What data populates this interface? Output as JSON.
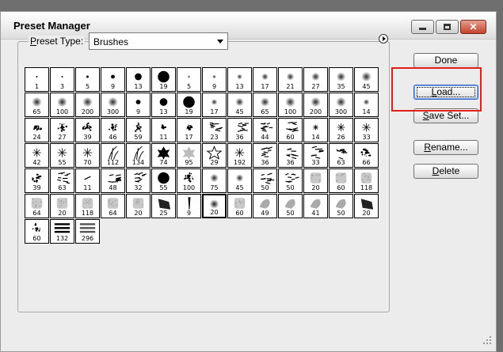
{
  "window": {
    "title": "Preset Manager"
  },
  "preset_type": {
    "label": "Preset Type:",
    "value": "Brushes"
  },
  "buttons": {
    "done": "Done",
    "load": "Load...",
    "save_set": "Save Set...",
    "rename": "Rename...",
    "delete": "Delete"
  },
  "colors": {
    "highlight": "#e0201a"
  },
  "brushes": [
    {
      "size": "1",
      "kind": "hard",
      "d": 2
    },
    {
      "size": "3",
      "kind": "hard",
      "d": 2
    },
    {
      "size": "5",
      "kind": "hard",
      "d": 3
    },
    {
      "size": "9",
      "kind": "hard",
      "d": 5
    },
    {
      "size": "13",
      "kind": "hard",
      "d": 9
    },
    {
      "size": "19",
      "kind": "hard",
      "d": 15
    },
    {
      "size": "5",
      "kind": "soft",
      "d": 3
    },
    {
      "size": "9",
      "kind": "soft",
      "d": 5
    },
    {
      "size": "13",
      "kind": "soft",
      "d": 7
    },
    {
      "size": "17",
      "kind": "soft",
      "d": 9
    },
    {
      "size": "21",
      "kind": "soft",
      "d": 10
    },
    {
      "size": "27",
      "kind": "soft",
      "d": 11
    },
    {
      "size": "35",
      "kind": "soft",
      "d": 12
    },
    {
      "size": "45",
      "kind": "soft",
      "d": 13
    },
    {
      "size": "65",
      "kind": "soft",
      "d": 13
    },
    {
      "size": "100",
      "kind": "soft",
      "d": 13
    },
    {
      "size": "200",
      "kind": "soft",
      "d": 13
    },
    {
      "size": "300",
      "kind": "soft",
      "d": 13
    },
    {
      "size": "9",
      "kind": "hard",
      "d": 6
    },
    {
      "size": "13",
      "kind": "hard",
      "d": 10
    },
    {
      "size": "19",
      "kind": "hard",
      "d": 15
    },
    {
      "size": "17",
      "kind": "soft",
      "d": 8
    },
    {
      "size": "45",
      "kind": "soft",
      "d": 11
    },
    {
      "size": "65",
      "kind": "soft",
      "d": 12
    },
    {
      "size": "100",
      "kind": "soft",
      "d": 13
    },
    {
      "size": "200",
      "kind": "soft",
      "d": 13
    },
    {
      "size": "300",
      "kind": "soft",
      "d": 13
    },
    {
      "size": "14",
      "kind": "soft",
      "d": 8
    },
    {
      "size": "24",
      "kind": "spatter",
      "d": 12
    },
    {
      "size": "27",
      "kind": "spatter",
      "d": 12
    },
    {
      "size": "39",
      "kind": "spatter",
      "d": 12
    },
    {
      "size": "46",
      "kind": "spatter",
      "d": 12
    },
    {
      "size": "59",
      "kind": "spatter",
      "d": 12
    },
    {
      "size": "11",
      "kind": "spatter",
      "d": 6
    },
    {
      "size": "17",
      "kind": "spatter",
      "d": 8
    },
    {
      "size": "23",
      "kind": "chalk",
      "d": 12
    },
    {
      "size": "36",
      "kind": "chalk",
      "d": 13
    },
    {
      "size": "44",
      "kind": "chalk",
      "d": 13
    },
    {
      "size": "60",
      "kind": "chalk",
      "d": 13
    },
    {
      "size": "14",
      "kind": "star",
      "d": 7
    },
    {
      "size": "26",
      "kind": "star",
      "d": 10
    },
    {
      "size": "33",
      "kind": "star",
      "d": 11
    },
    {
      "size": "42",
      "kind": "star",
      "d": 11
    },
    {
      "size": "55",
      "kind": "star",
      "d": 12
    },
    {
      "size": "70",
      "kind": "star",
      "d": 12
    },
    {
      "size": "112",
      "kind": "grass",
      "d": 14
    },
    {
      "size": "134",
      "kind": "grass",
      "d": 14
    },
    {
      "size": "74",
      "kind": "leaf",
      "d": 14
    },
    {
      "size": "95",
      "kind": "leaf-light",
      "d": 14
    },
    {
      "size": "29",
      "kind": "star-outline",
      "d": 14
    },
    {
      "size": "192",
      "kind": "star",
      "d": 12
    },
    {
      "size": "36",
      "kind": "chalk",
      "d": 13
    },
    {
      "size": "36",
      "kind": "chalk",
      "d": 13
    },
    {
      "size": "33",
      "kind": "chalk",
      "d": 13
    },
    {
      "size": "63",
      "kind": "chalk",
      "d": 13
    },
    {
      "size": "66",
      "kind": "spatter",
      "d": 13
    },
    {
      "size": "39",
      "kind": "spatter",
      "d": 12
    },
    {
      "size": "63",
      "kind": "chalk",
      "d": 13
    },
    {
      "size": "11",
      "kind": "stroke",
      "d": 6
    },
    {
      "size": "48",
      "kind": "chalk",
      "d": 13
    },
    {
      "size": "32",
      "kind": "chalk",
      "d": 13
    },
    {
      "size": "55",
      "kind": "hard",
      "d": 15
    },
    {
      "size": "100",
      "kind": "spatter",
      "d": 13
    },
    {
      "size": "75",
      "kind": "soft",
      "d": 11
    },
    {
      "size": "45",
      "kind": "soft",
      "d": 10
    },
    {
      "size": "50",
      "kind": "chalk",
      "d": 13
    },
    {
      "size": "50",
      "kind": "chalk",
      "d": 13
    },
    {
      "size": "20",
      "kind": "texture",
      "d": 13
    },
    {
      "size": "60",
      "kind": "texture",
      "d": 13
    },
    {
      "size": "118",
      "kind": "texture",
      "d": 13
    },
    {
      "size": "64",
      "kind": "texture",
      "d": 13
    },
    {
      "size": "20",
      "kind": "texture",
      "d": 13
    },
    {
      "size": "118",
      "kind": "texture",
      "d": 13
    },
    {
      "size": "64",
      "kind": "texture",
      "d": 13
    },
    {
      "size": "20",
      "kind": "texture",
      "d": 13
    },
    {
      "size": "25",
      "kind": "wet",
      "d": 13
    },
    {
      "size": "9",
      "kind": "drip",
      "d": 10
    },
    {
      "size": "20",
      "kind": "dark-soft",
      "d": 13
    },
    {
      "size": "60",
      "kind": "texture",
      "d": 13
    },
    {
      "size": "49",
      "kind": "smear",
      "d": 13
    },
    {
      "size": "50",
      "kind": "smear",
      "d": 13
    },
    {
      "size": "41",
      "kind": "smear",
      "d": 13
    },
    {
      "size": "50",
      "kind": "smear",
      "d": 13
    },
    {
      "size": "20",
      "kind": "wet",
      "d": 13
    },
    {
      "size": "60",
      "kind": "grunge",
      "d": 13
    },
    {
      "size": "132",
      "kind": "stamp",
      "d": 13
    },
    {
      "size": "296",
      "kind": "stamp2",
      "d": 13
    }
  ]
}
